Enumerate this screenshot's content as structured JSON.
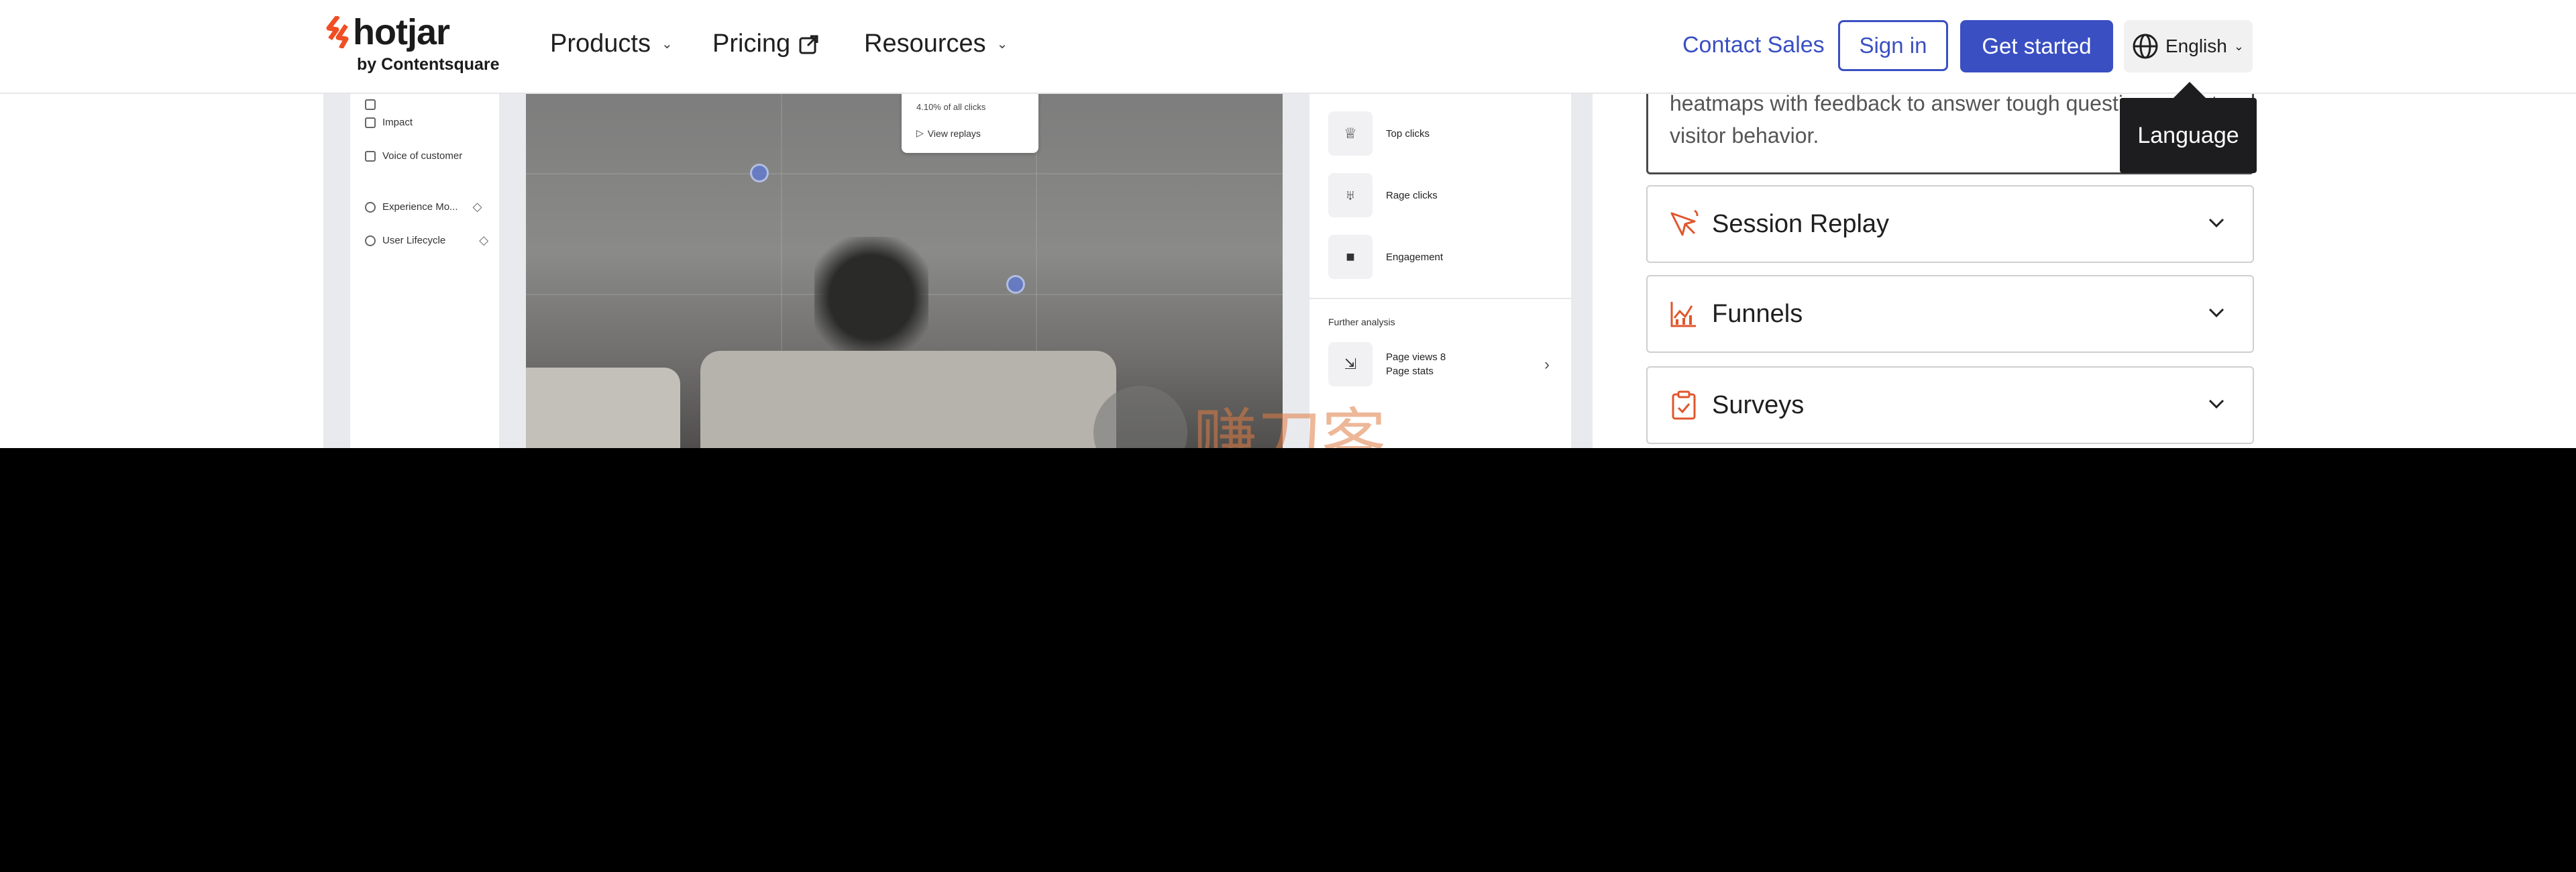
{
  "header": {
    "logo_word": "hotjar",
    "logo_sub": "by Contentsquare",
    "nav": [
      {
        "label": "Products"
      },
      {
        "label": "Pricing"
      },
      {
        "label": "Resources"
      }
    ],
    "contact_sales": "Contact Sales",
    "sign_in": "Sign in",
    "get_started": "Get started",
    "language": "English",
    "accent": "#3a4fc2",
    "brand": "#f04e23"
  },
  "tooltip": "Language",
  "mock": {
    "sidebar": [
      "Impact",
      "Voice of customer",
      "Experience Mo...",
      "User Lifecycle"
    ],
    "popup_text": "4.10% of all clicks",
    "popup_button": "View replays",
    "right_items": [
      "Top clicks",
      "Rage clicks",
      "Engagement"
    ],
    "further_title": "Further analysis",
    "further_line1": "Page views 8",
    "further_line2": "Page stats"
  },
  "watermark": "赚刀客",
  "card_text": "heatmaps with feedback to answer tough questions about visitor behavior.",
  "accordion": [
    {
      "label": "Session Replay",
      "icon": "session-replay-icon"
    },
    {
      "label": "Funnels",
      "icon": "funnels-icon"
    },
    {
      "label": "Surveys",
      "icon": "surveys-icon"
    }
  ]
}
